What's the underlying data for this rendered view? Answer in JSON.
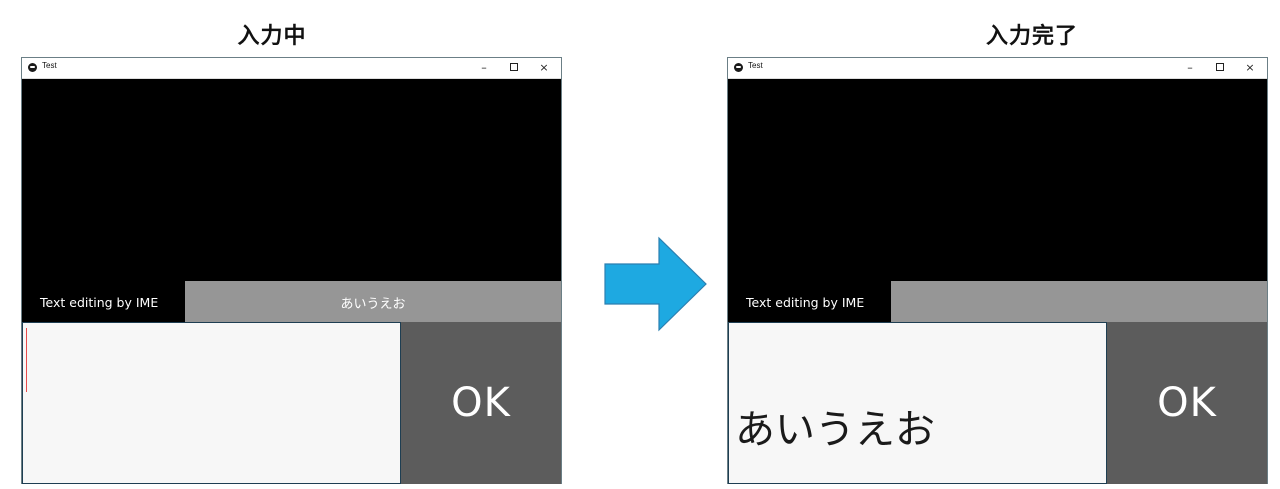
{
  "panels": [
    {
      "caption": "入力中",
      "window": {
        "title": "Test",
        "controls": {
          "minimize": "–",
          "close": "×"
        },
        "label_text": "Text editing by IME",
        "ime_text": "あいうえお",
        "input_value": "",
        "caret_visible": true,
        "ok_label": "OK"
      }
    },
    {
      "caption": "入力完了",
      "window": {
        "title": "Test",
        "controls": {
          "minimize": "–",
          "close": "×"
        },
        "label_text": "Text editing by IME",
        "ime_text": "",
        "input_value": "あいうえお",
        "caret_visible": false,
        "ok_label": "OK"
      }
    }
  ],
  "transition_arrow": {
    "icon": "right-arrow-icon",
    "color": "#1ea9e1"
  },
  "colors": {
    "label_bar": "#000000",
    "ime_bar": "#969696",
    "input_bg": "#f7f7f7",
    "ok_bg": "#5c5c5c",
    "caret": "#e84c4c"
  }
}
